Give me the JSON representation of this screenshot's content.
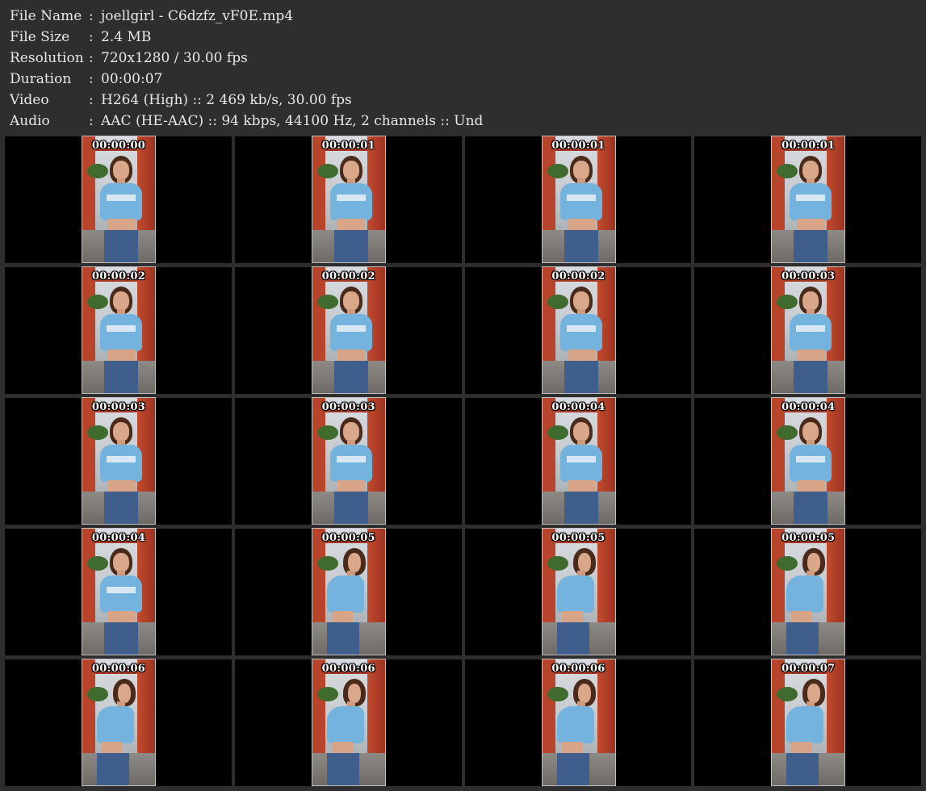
{
  "info": [
    {
      "label": "File Name",
      "sep": ":",
      "value": "joellgirl - C6dzfz_vF0E.mp4"
    },
    {
      "label": "File Size",
      "sep": ":",
      "value": "2.4 MB"
    },
    {
      "label": "Resolution",
      "sep": ":",
      "value": "720x1280 / 30.00 fps"
    },
    {
      "label": "Duration",
      "sep": ":",
      "value": "00:00:07"
    },
    {
      "label": "Video",
      "sep": ":",
      "value": "H264 (High) :: 2 469 kb/s, 30.00 fps"
    },
    {
      "label": "Audio",
      "sep": ":",
      "value": "AAC (HE-AAC) :: 94 kbps, 44100 Hz, 2 channels :: Und"
    }
  ],
  "thumbnails": [
    {
      "time": "00:00:00",
      "pose": "front"
    },
    {
      "time": "00:00:01",
      "pose": "front"
    },
    {
      "time": "00:00:01",
      "pose": "front"
    },
    {
      "time": "00:00:01",
      "pose": "front"
    },
    {
      "time": "00:00:02",
      "pose": "front"
    },
    {
      "time": "00:00:02",
      "pose": "front"
    },
    {
      "time": "00:00:02",
      "pose": "front"
    },
    {
      "time": "00:00:03",
      "pose": "front"
    },
    {
      "time": "00:00:03",
      "pose": "front"
    },
    {
      "time": "00:00:03",
      "pose": "front"
    },
    {
      "time": "00:00:04",
      "pose": "front"
    },
    {
      "time": "00:00:04",
      "pose": "front"
    },
    {
      "time": "00:00:04",
      "pose": "front"
    },
    {
      "time": "00:00:05",
      "pose": "turn"
    },
    {
      "time": "00:00:05",
      "pose": "turn"
    },
    {
      "time": "00:00:05",
      "pose": "turn"
    },
    {
      "time": "00:00:06",
      "pose": "turn"
    },
    {
      "time": "00:00:06",
      "pose": "turn"
    },
    {
      "time": "00:00:06",
      "pose": "turn"
    },
    {
      "time": "00:00:07",
      "pose": "turn"
    }
  ],
  "grid": {
    "columns": 4,
    "rows": 5
  }
}
